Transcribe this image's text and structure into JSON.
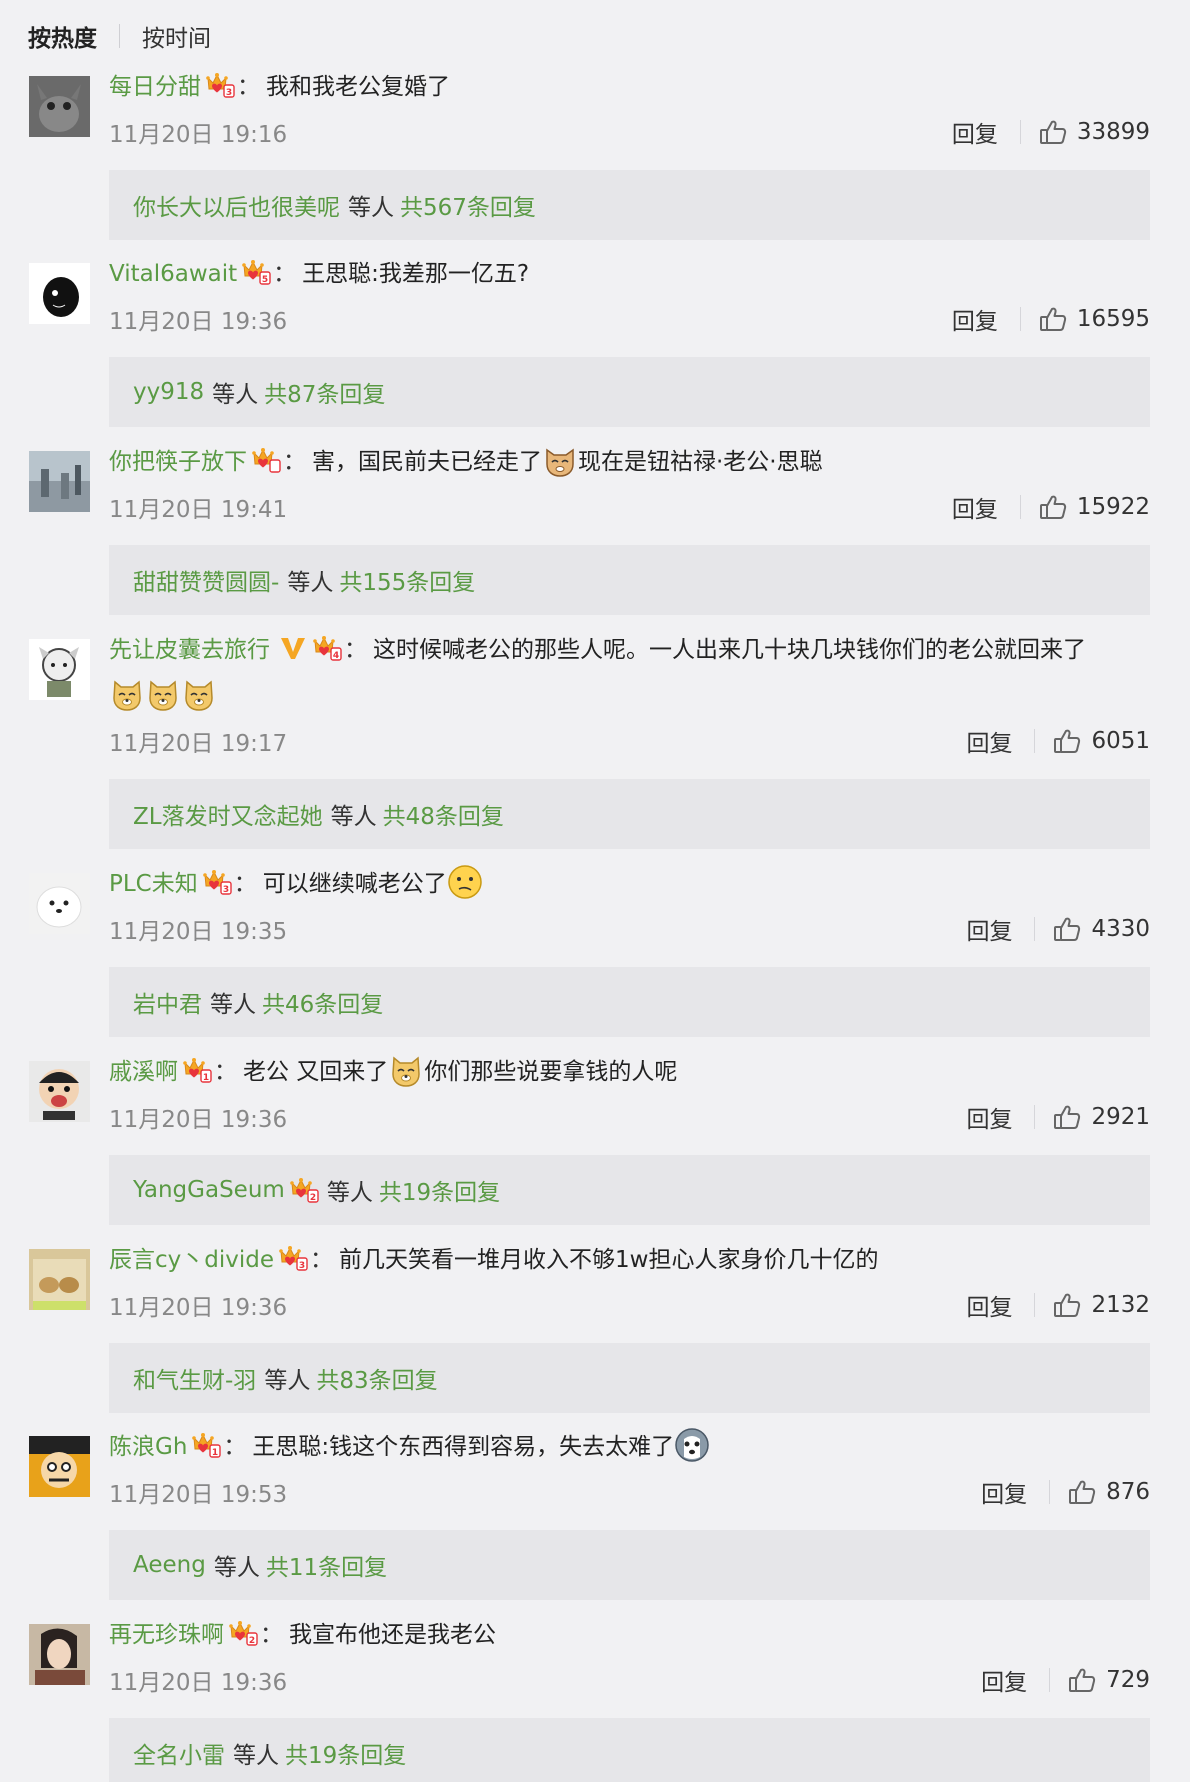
{
  "sort": {
    "hot_label": "按热度",
    "time_label": "按时间"
  },
  "ui": {
    "reply_label": "回复",
    "colon": "："
  },
  "comments": [
    {
      "user": "每日分甜",
      "text_before": "我和我老公复婚了",
      "emoji": "",
      "text_after": "",
      "time": "11月20日 19:16",
      "likes": "33899",
      "reply_user": "你长大以后也很美呢",
      "reply_etc": "等人",
      "reply_count": "共567条回复",
      "badge_level": "3"
    },
    {
      "user": "Vital6await",
      "text_before": "王思聪:我差那一亿五?",
      "emoji": "",
      "text_after": "",
      "time": "11月20日 19:36",
      "likes": "16595",
      "reply_user": "yy918",
      "reply_etc": "等人",
      "reply_count": "共87条回复",
      "badge_level": "5"
    },
    {
      "user": "你把筷子放下",
      "text_before": "害，国民前夫已经走了",
      "emoji": "cat-emoji",
      "text_after": "现在是钮祜禄·老公·思聪",
      "time": "11月20日 19:41",
      "likes": "15922",
      "reply_user": "甜甜赞赞圆圆-",
      "reply_etc": "等人",
      "reply_count": "共155条回复",
      "badge_level": ""
    },
    {
      "user": "先让皮囊去旅行",
      "text_before": "这时候喊老公的那些人呢。一人出来几十块几块钱你们的老公就回来了",
      "emoji": "doge-emoji-x3",
      "text_after": "",
      "time": "11月20日 19:17",
      "likes": "6051",
      "reply_user": "ZL落发时又念起她",
      "reply_etc": "等人",
      "reply_count": "共48条回复",
      "badge_level": "4"
    },
    {
      "user": "PLC未知",
      "text_before": "可以继续喊老公了",
      "emoji": "thinking-emoji",
      "text_after": "",
      "time": "11月20日 19:35",
      "likes": "4330",
      "reply_user": "岩中君",
      "reply_etc": "等人",
      "reply_count": "共46条回复",
      "badge_level": "3"
    },
    {
      "user": "戚溪啊",
      "text_before": "老公 又回来了",
      "emoji": "doge-emoji",
      "text_after": "你们那些说要拿钱的人呢",
      "time": "11月20日 19:36",
      "likes": "2921",
      "reply_user": "YangGaSeum",
      "reply_etc": "等人",
      "reply_count": "共19条回复",
      "badge_level": "1"
    },
    {
      "user": "辰言cy丶divide",
      "text_before": "前几天笑看一堆月收入不够1w担心人家身价几十亿的",
      "emoji": "",
      "text_after": "",
      "time": "11月20日 19:36",
      "likes": "2132",
      "reply_user": "和气生财-羽",
      "reply_etc": "等人",
      "reply_count": "共83条回复",
      "badge_level": "3"
    },
    {
      "user": "陈浪Gh",
      "text_before": "王思聪:钱这个东西得到容易，失去太难了",
      "emoji": "husky-emoji",
      "text_after": "",
      "time": "11月20日 19:53",
      "likes": "876",
      "reply_user": "Aeeng",
      "reply_etc": "等人",
      "reply_count": "共11条回复",
      "badge_level": "1"
    },
    {
      "user": "再无珍珠啊",
      "text_before": "我宣布他还是我老公",
      "emoji": "",
      "text_after": "",
      "time": "11月20日 19:36",
      "likes": "729",
      "reply_user": "全名小雷",
      "reply_etc": "等人",
      "reply_count": "共19条回复",
      "badge_level": "2"
    }
  ],
  "colors": {
    "username": "#5a9a44",
    "background": "#f1f1f3",
    "reply_box": "#e6e6e9",
    "badge": "#f5a623",
    "badge_heart": "#e8343c"
  }
}
